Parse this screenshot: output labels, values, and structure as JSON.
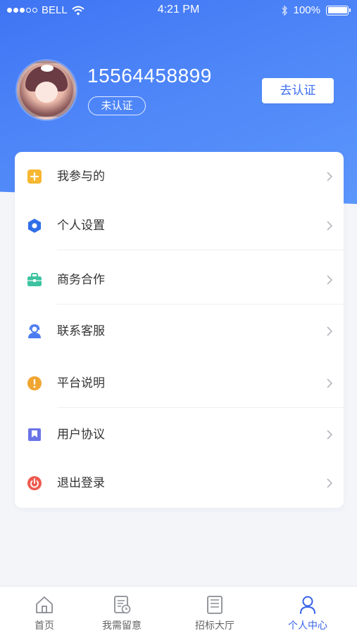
{
  "status_bar": {
    "carrier": "BELL",
    "time": "4:21 PM",
    "battery": "100%",
    "battery_level": 1.0
  },
  "profile": {
    "phone": "15564458899",
    "verify_status": "未认证",
    "verify_button": "去认证"
  },
  "menu": {
    "items": [
      {
        "label": "我参与的",
        "icon": "plus-square-icon",
        "color": "#f7b731"
      },
      {
        "label": "个人设置",
        "icon": "hexagon-settings-icon",
        "color": "#2f6ee8"
      },
      {
        "label": "商务合作",
        "icon": "briefcase-icon",
        "color": "#3cc3a0"
      },
      {
        "label": "联系客服",
        "icon": "customer-service-icon",
        "color": "#4a7bf0"
      },
      {
        "label": "平台说明",
        "icon": "exclamation-circle-icon",
        "color": "#f0a531"
      },
      {
        "label": "用户协议",
        "icon": "bookmark-icon",
        "color": "#6a74e8"
      },
      {
        "label": "退出登录",
        "icon": "power-icon",
        "color": "#ef5a4f"
      }
    ]
  },
  "tabbar": {
    "tabs": [
      {
        "label": "首页",
        "icon": "home-icon"
      },
      {
        "label": "我需留意",
        "icon": "document-clock-icon"
      },
      {
        "label": "招标大厅",
        "icon": "document-list-icon"
      },
      {
        "label": "个人中心",
        "icon": "person-icon"
      }
    ],
    "active_index": 3,
    "active_color": "#3562e8"
  }
}
